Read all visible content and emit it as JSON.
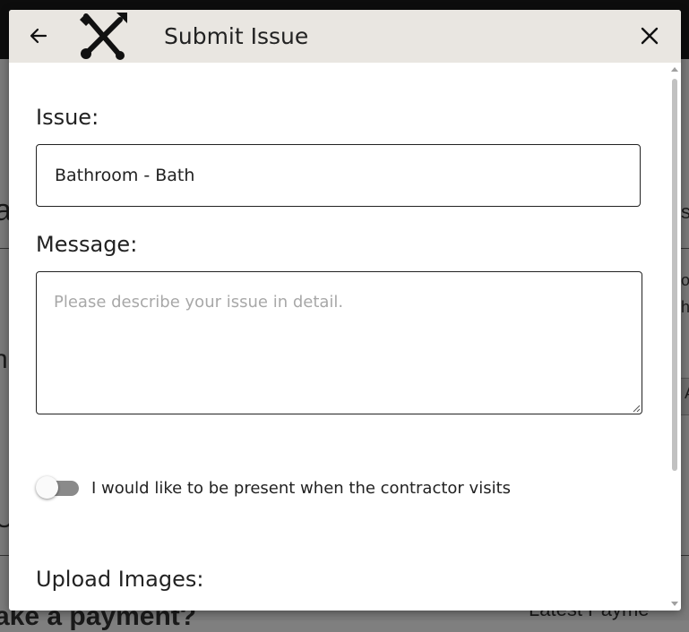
{
  "background": {
    "heading_fragment": "ake a payment?",
    "right_fragment": "Latest Payme",
    "left_letters": [
      "a",
      "n",
      "U"
    ],
    "right_letters": [
      "s",
      "o",
      "h",
      "A"
    ]
  },
  "modal": {
    "title": "Submit Issue",
    "back_icon": "arrow-left-icon",
    "logo_icon": "hammer-wrench-tools-icon",
    "close_icon": "close-icon",
    "issue_label": "Issue:",
    "issue_value": "Bathroom - Bath",
    "message_label": "Message:",
    "message_placeholder": "Please describe your issue in detail.",
    "message_value": "",
    "toggle": {
      "label": "I would like to be present when the contractor visits",
      "checked": false
    },
    "upload_label": "Upload Images:"
  }
}
